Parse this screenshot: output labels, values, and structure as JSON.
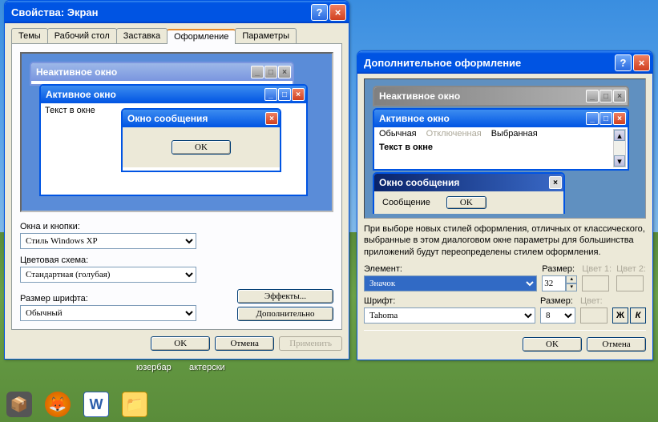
{
  "win1": {
    "title": "Свойства: Экран",
    "tabs": [
      "Темы",
      "Рабочий стол",
      "Заставка",
      "Оформление",
      "Параметры"
    ],
    "active_tab": 3,
    "preview": {
      "inactive": "Неактивное окно",
      "active": "Активное окно",
      "text_in_window": "Текст в окне",
      "msgbox_title": "Окно сообщения",
      "ok": "OK"
    },
    "labels": {
      "windows_and_buttons": "Окна и кнопки:",
      "color_scheme": "Цветовая схема:",
      "font_size": "Размер шрифта:"
    },
    "values": {
      "style": "Стиль Windows XP",
      "scheme": "Стандартная (голубая)",
      "fontsize": "Обычный"
    },
    "buttons": {
      "effects": "Эффекты...",
      "advanced": "Дополнительно",
      "ok": "OK",
      "cancel": "Отмена",
      "apply": "Применить"
    }
  },
  "win2": {
    "title": "Дополнительное оформление",
    "preview": {
      "inactive": "Неактивное окно",
      "active": "Активное окно",
      "menu_normal": "Обычная",
      "menu_disabled": "Отключенная",
      "menu_selected": "Выбранная",
      "text_in_window": "Текст в окне",
      "msgbox_title": "Окно сообщения",
      "msgbox_text": "Сообщение",
      "ok": "OK"
    },
    "info": "При выборе новых стилей оформления, отличных от классического, выбранные в этом диалоговом окне параметры для большинства приложений будут переопределены стилем оформления.",
    "labels": {
      "element": "Элемент:",
      "size": "Размер:",
      "color1": "Цвет 1:",
      "color2": "Цвет 2:",
      "font": "Шрифт:",
      "fsize": "Размер:",
      "fcolor": "Цвет:"
    },
    "values": {
      "element": "Значок",
      "size": "32",
      "font": "Tahoma",
      "fsize": "8"
    },
    "buttons": {
      "bold": "Ж",
      "italic": "К",
      "ok": "OK",
      "cancel": "Отмена"
    }
  },
  "desktop": {
    "folder1": "юзербар",
    "folder2": "актерски"
  }
}
